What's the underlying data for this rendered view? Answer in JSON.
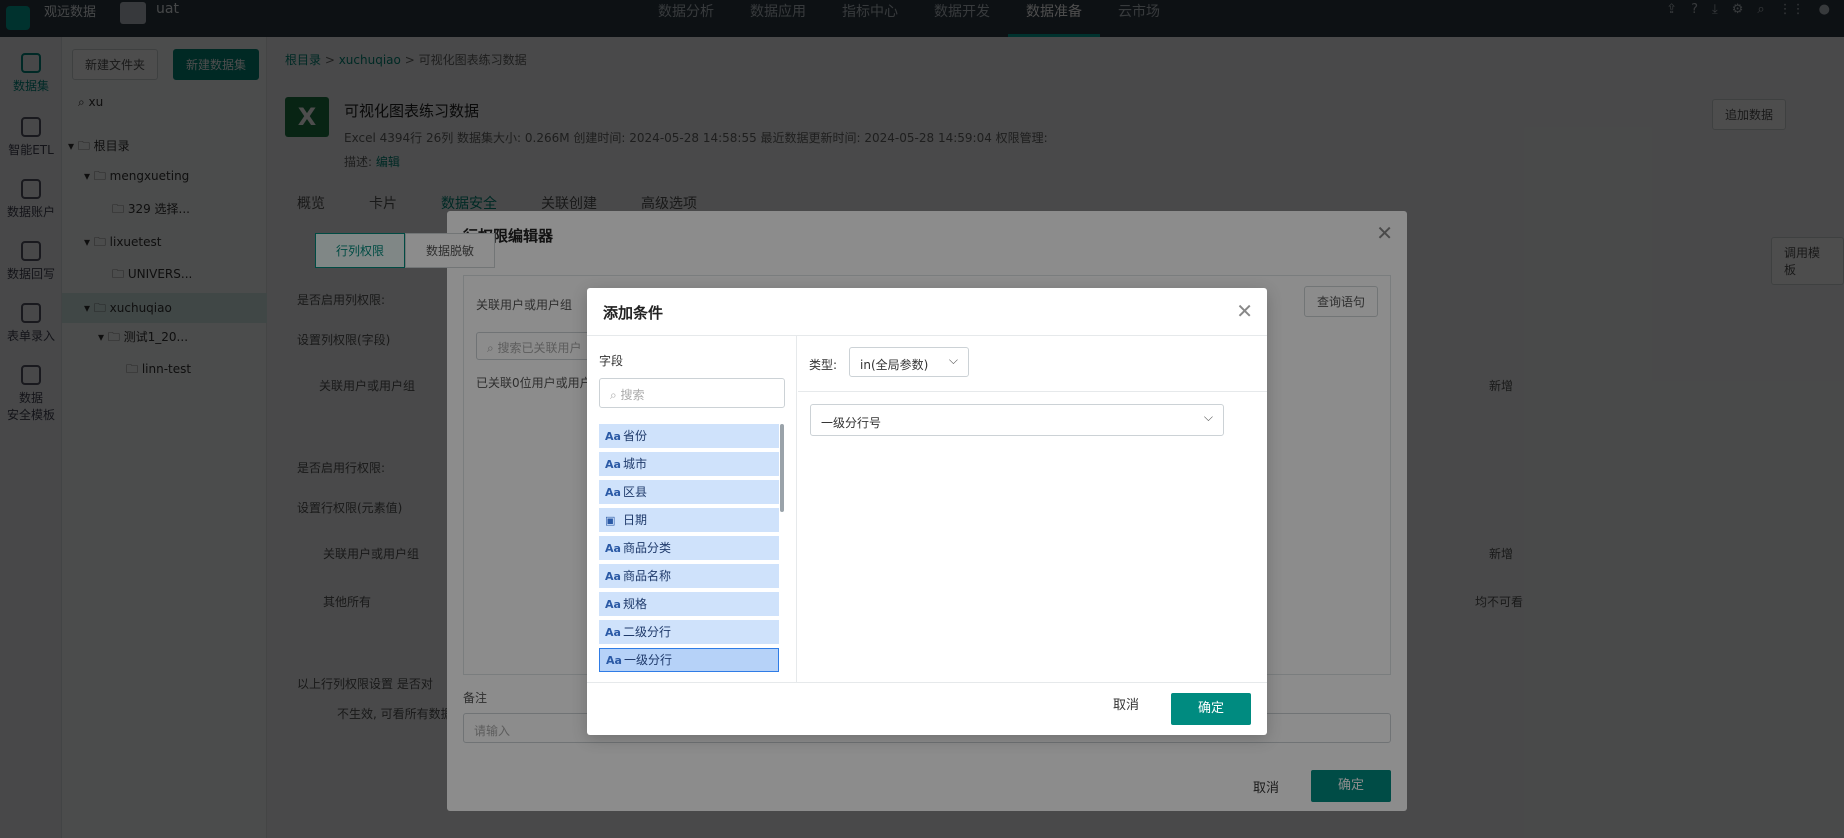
{
  "topnav": {
    "brand": "观远数据",
    "env": "uat",
    "tabs": [
      "数据分析",
      "数据应用",
      "指标中心",
      "数据开发",
      "数据准备",
      "云市场"
    ],
    "active_tab": "数据准备"
  },
  "sidebar": {
    "items": [
      {
        "label": "数据集",
        "active": true
      },
      {
        "label": "智能ETL"
      },
      {
        "label": "数据账户"
      },
      {
        "label": "数据回写"
      },
      {
        "label": "表单录入"
      },
      {
        "label": "数据\n安全模板"
      }
    ]
  },
  "tree": {
    "new_folder": "新建文件夹",
    "new_dataset": "新建数据集",
    "search_value": "xu",
    "nodes": [
      "根目录",
      "mengxueting",
      "329 选择...",
      "lixuetest",
      "UNIVERS...",
      "xuchuqiao",
      "测试1_20...",
      "linn-test"
    ]
  },
  "main": {
    "breadcrumb": [
      "根目录",
      "xuchuqiao",
      "可视化图表练习数据"
    ],
    "dataset_title": "可视化图表练习数据",
    "meta": "Excel    4394行    26列    数据集大小: 0.266M    创建时间: 2024-05-28 14:58:55    最近数据更新时间: 2024-05-28 14:59:04    权限管理:",
    "desc_label": "描述:",
    "desc_edit": "编辑",
    "tabs": [
      "概览",
      "卡片",
      "数据安全",
      "关联创建",
      "高级选项"
    ],
    "active_tab": "数据安全",
    "add_data": "追加数据",
    "bg_col_perm_label": "是否启用列权限:",
    "bg_col_perm_setting": "设置列权限(字段)",
    "bg_row_perm_label": "是否启用行权限:",
    "bg_row_perm_setting": "设置行权限(元素值)",
    "bg_assoc_user": "关联用户或用户组",
    "bg_add": "新增",
    "bg_other": "其他所有",
    "bg_invisible": "均不可看",
    "bg_note_prefix": "以上行列权限设置 是否对",
    "bg_not_effect": "不生效, 可看所有数据",
    "bg_template": "调用模板"
  },
  "modal1": {
    "title": "行权限编辑器",
    "tabs": [
      "行列权限",
      "数据脱敏"
    ],
    "assoc_label": "关联用户或用户组",
    "search_placeholder": "搜索已关联用户",
    "assoc_count": "已关联0位用户或用户",
    "query_btn": "查询语句",
    "remark_label": "备注",
    "remark_placeholder": "请输入",
    "cancel": "取消",
    "ok": "确定"
  },
  "modal2": {
    "title": "添加条件",
    "field_label": "字段",
    "search_placeholder": "搜索",
    "fields": [
      {
        "name": "省份",
        "type": "text"
      },
      {
        "name": "城市",
        "type": "text"
      },
      {
        "name": "区县",
        "type": "text"
      },
      {
        "name": "日期",
        "type": "date"
      },
      {
        "name": "商品分类",
        "type": "text"
      },
      {
        "name": "商品名称",
        "type": "text"
      },
      {
        "name": "规格",
        "type": "text"
      },
      {
        "name": "二级分行",
        "type": "text"
      },
      {
        "name": "一级分行",
        "type": "text",
        "selected": true
      }
    ],
    "type_label": "类型:",
    "type_value": "in(全局参数)",
    "param_value": "一级分行号",
    "cancel": "取消",
    "ok": "确定"
  }
}
